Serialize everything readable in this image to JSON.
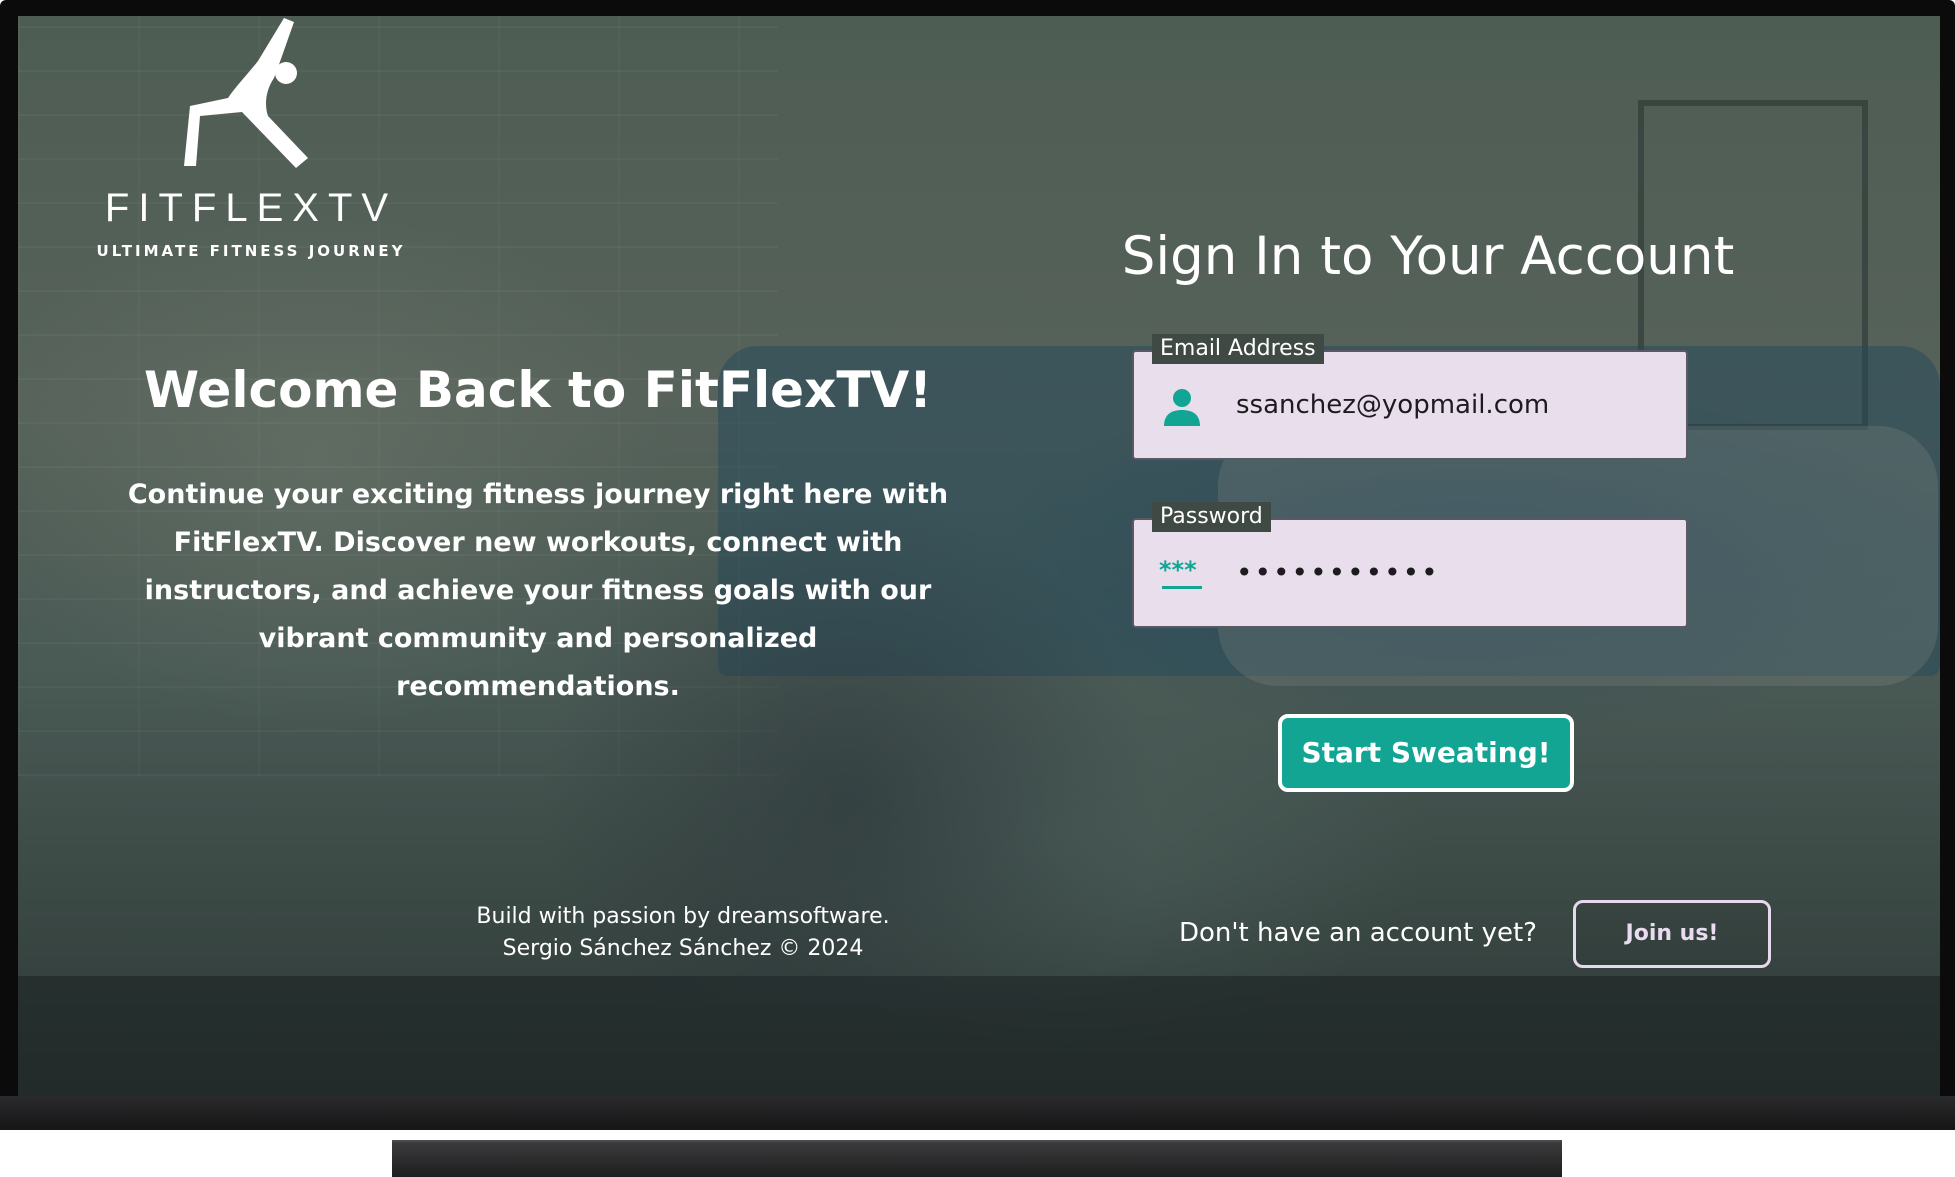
{
  "brand": {
    "name": "FITFLEXTV",
    "tagline": "ULTIMATE FITNESS JOURNEY",
    "logo_icon": "yoga-pose-icon"
  },
  "welcome": {
    "title": "Welcome Back to FitFlexTV!",
    "text": "Continue your exciting fitness journey right here with FitFlexTV. Discover new workouts, connect with instructors, and achieve your fitness goals with our vibrant community and personalized recommendations."
  },
  "credits": {
    "line1": "Build with passion by dreamsoftware.",
    "line2": "Sergio Sánchez Sánchez © 2024"
  },
  "form": {
    "title": "Sign In to Your Account",
    "email": {
      "label": "Email Address",
      "value": "ssanchez@yopmail.com",
      "icon": "person-icon"
    },
    "password": {
      "label": "Password",
      "value": "•••••••••••",
      "icon": "password-icon"
    },
    "submit_label": "Start Sweating!",
    "signup_prompt": "Don't have an account yet?",
    "join_label": "Join us!"
  },
  "colors": {
    "accent": "#13a594",
    "field_bg": "#e9dfec",
    "join_border": "#e6d9ec"
  }
}
